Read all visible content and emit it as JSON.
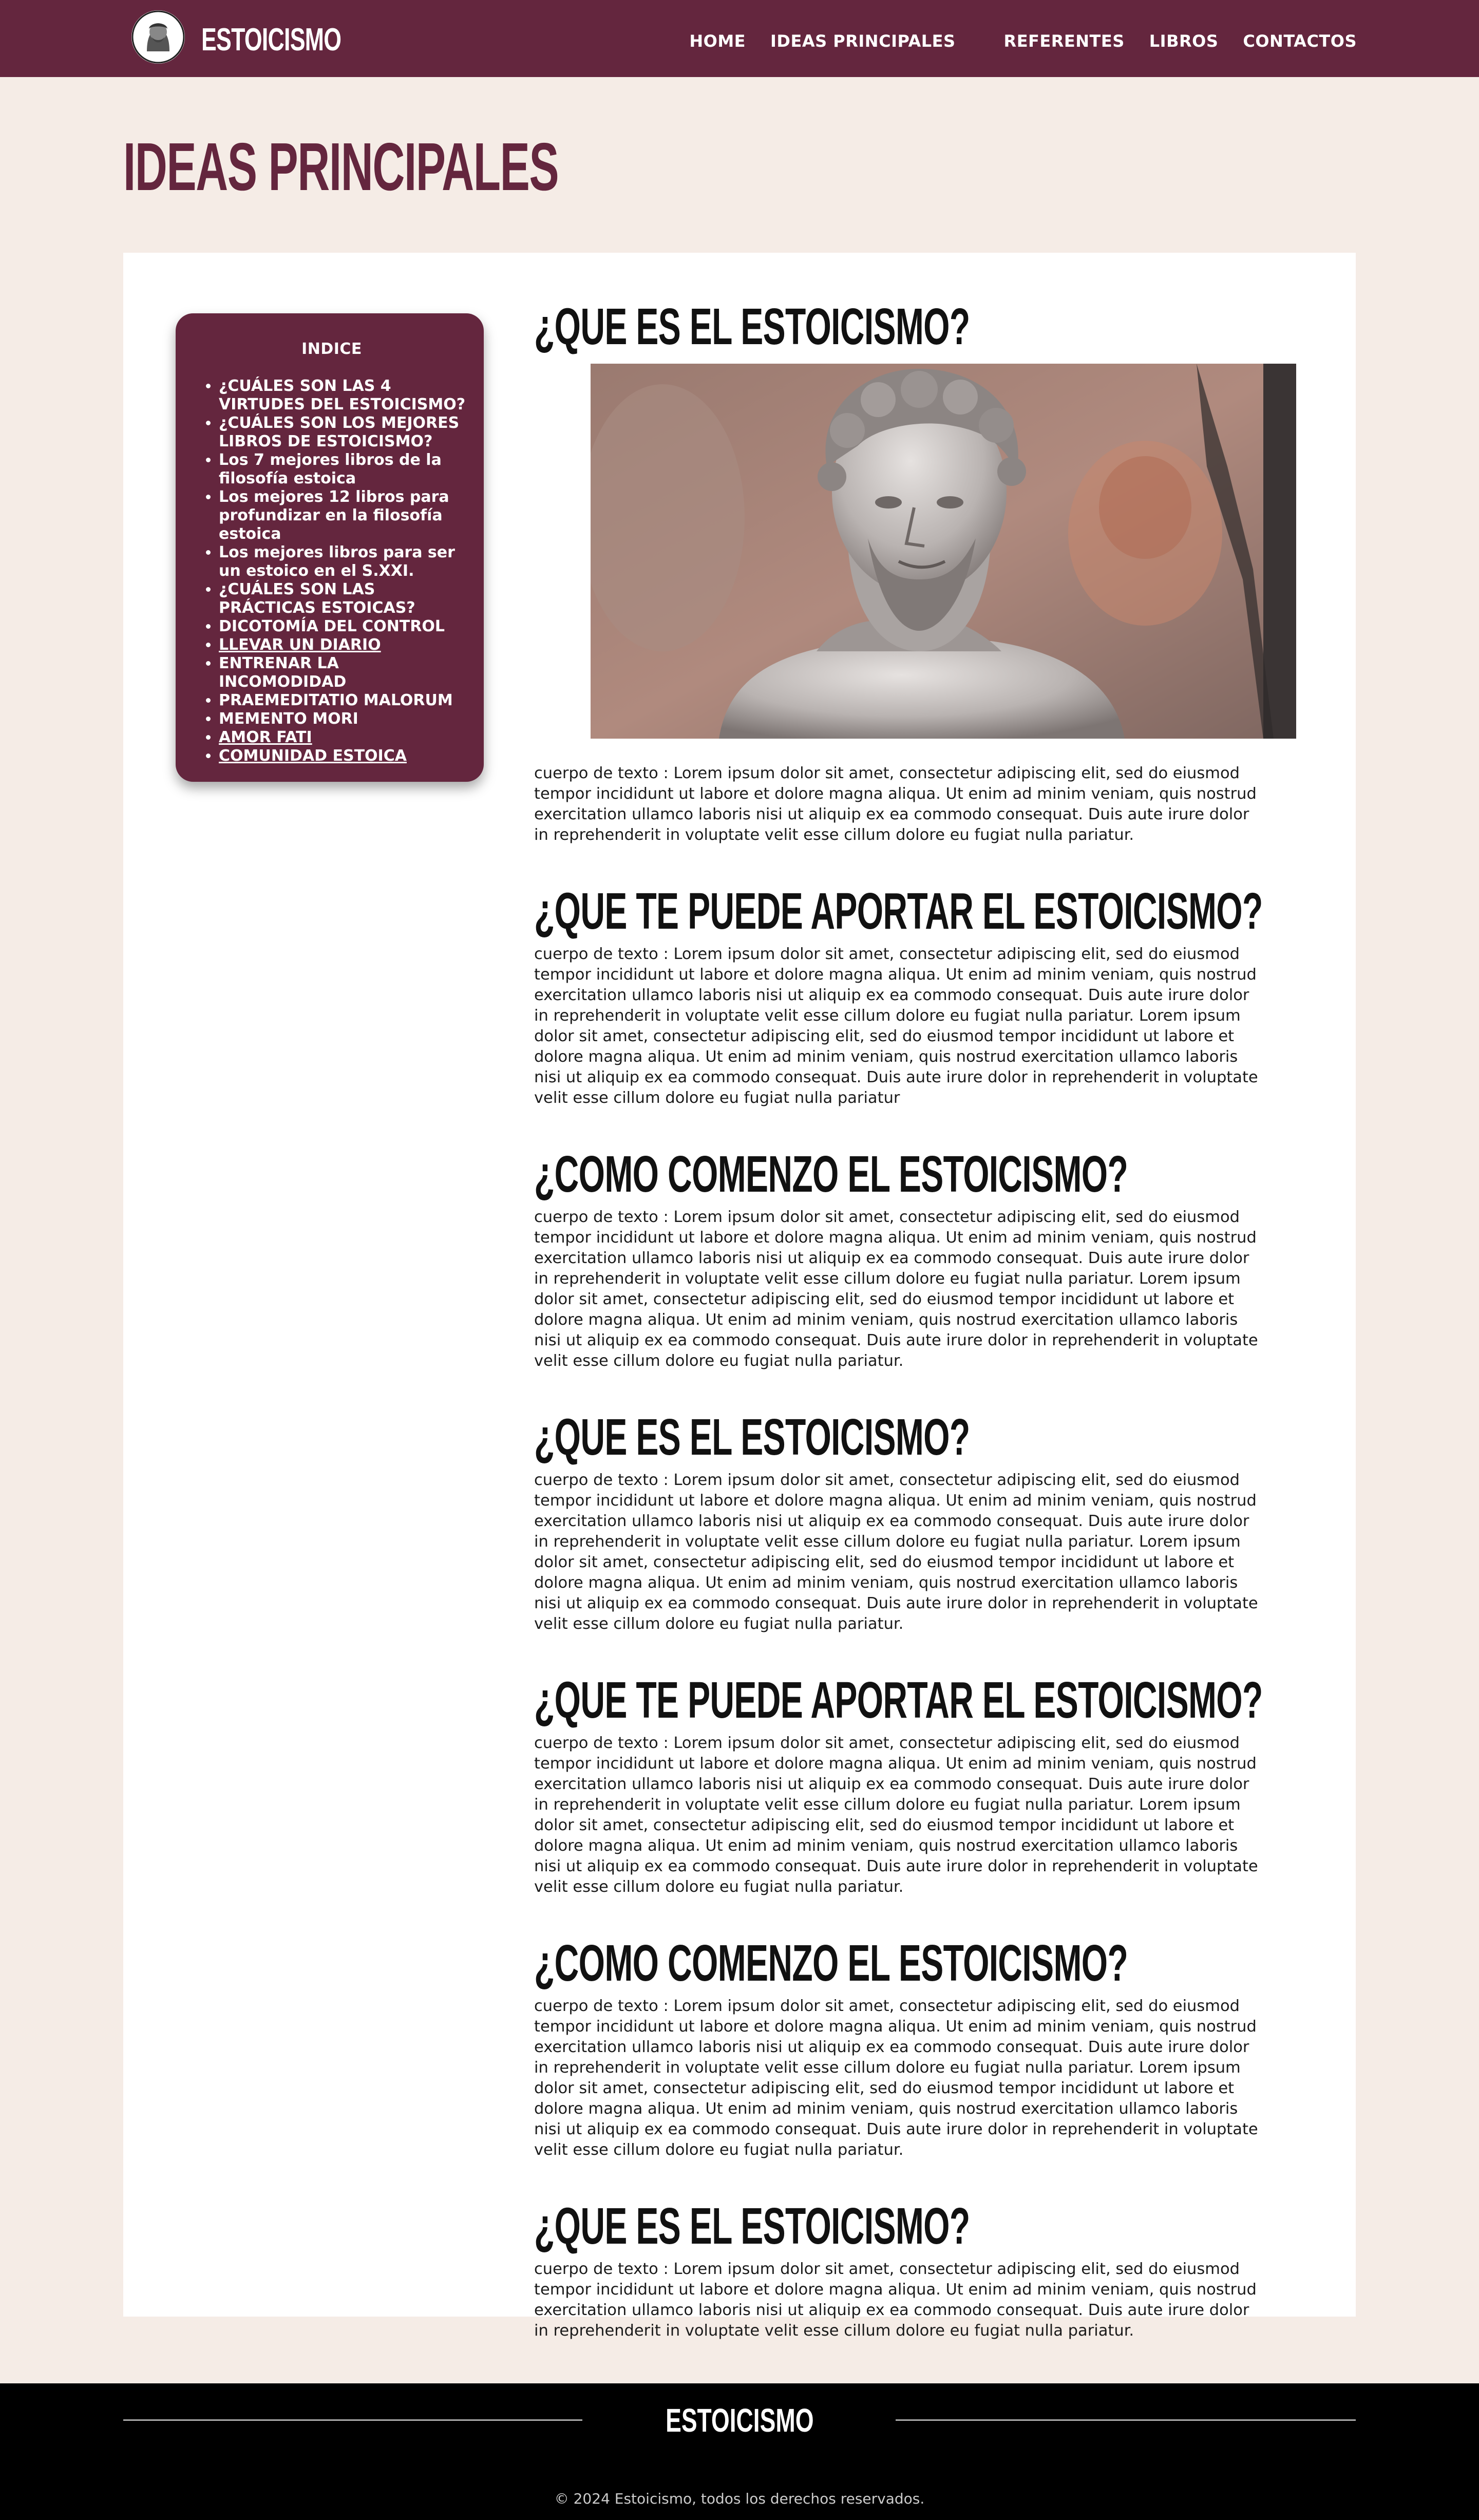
{
  "nav": {
    "brand": "ESTOICISMO",
    "logo_icon": "stoic-bust-logo-icon",
    "links": [
      "HOME",
      "IDEAS PRINCIPALES",
      "REFERENTES",
      "LIBROS",
      "CONTACTOS"
    ]
  },
  "page": {
    "title": "IDEAS PRINCIPALES"
  },
  "toc": {
    "title": "INDICE",
    "items": [
      "¿CUÁLES SON LAS 4 VIRTUDES DEL ESTOICISMO?",
      "¿CUÁLES SON LOS MEJORES LIBROS DE ESTOICISMO?",
      "Los 7 mejores libros de la filosofía estoica",
      "Los mejores 12 libros para profundizar en la filosofía estoica",
      "Los mejores libros para ser un estoico en el S.XXI.",
      "¿CUÁLES SON LAS PRÁCTICAS ESTOICAS?",
      "DICOTOMÍA DEL CONTROL",
      "LLEVAR UN DIARIO",
      "ENTRENAR LA INCOMODIDAD",
      "PRAEMEDITATIO MALORUM",
      "MEMENTO MORI",
      "AMOR FATI",
      "COMUNIDAD ESTOICA"
    ]
  },
  "image": {
    "alt": "Busto de mármol de Marco Aurelio"
  },
  "sections": [
    {
      "heading": "¿QUE ES EL ESTOICISMO?",
      "body": "cuerpo de texto : Lorem ipsum dolor sit amet, consectetur adipiscing elit, sed do eiusmod tempor incididunt ut labore et dolore magna aliqua. Ut enim ad minim veniam, quis nostrud exercitation ullamco laboris nisi ut aliquip ex ea commodo consequat. Duis aute irure dolor in reprehenderit in voluptate velit esse cillum dolore eu fugiat nulla pariatur."
    },
    {
      "heading": "¿QUE TE PUEDE APORTAR EL ESTOICISMO?",
      "body": "cuerpo de texto : Lorem ipsum dolor sit amet, consectetur adipiscing elit, sed do eiusmod tempor incididunt ut labore et dolore magna aliqua. Ut enim ad minim veniam, quis nostrud exercitation ullamco laboris nisi ut aliquip ex ea commodo consequat. Duis aute irure dolor in reprehenderit in voluptate velit esse cillum dolore eu fugiat nulla pariatur. Lorem ipsum dolor sit amet, consectetur adipiscing elit, sed do eiusmod tempor incididunt ut labore et dolore magna aliqua. Ut enim ad minim veniam, quis nostrud exercitation ullamco laboris nisi ut aliquip ex ea commodo consequat. Duis aute irure dolor in reprehenderit in voluptate velit esse cillum dolore eu fugiat nulla pariatur"
    },
    {
      "heading": "¿COMO COMENZO EL ESTOICISMO?",
      "body": "cuerpo de texto : Lorem ipsum dolor sit amet, consectetur adipiscing elit, sed do eiusmod tempor incididunt ut labore et dolore magna aliqua. Ut enim ad minim veniam, quis nostrud exercitation ullamco laboris nisi ut aliquip ex ea commodo consequat. Duis aute irure dolor in reprehenderit in voluptate velit esse cillum dolore eu fugiat nulla pariatur. Lorem ipsum dolor sit amet, consectetur adipiscing elit, sed do eiusmod tempor incididunt ut labore et dolore magna aliqua. Ut enim ad minim veniam, quis nostrud exercitation ullamco laboris nisi ut aliquip ex ea commodo consequat. Duis aute irure dolor in reprehenderit in voluptate velit esse cillum dolore eu fugiat nulla pariatur."
    },
    {
      "heading": "¿QUE ES EL ESTOICISMO?",
      "body": "cuerpo de texto : Lorem ipsum dolor sit amet, consectetur adipiscing elit, sed do eiusmod tempor incididunt ut labore et dolore magna aliqua. Ut enim ad minim veniam, quis nostrud exercitation ullamco laboris nisi ut aliquip ex ea commodo consequat. Duis aute irure dolor in reprehenderit in voluptate velit esse cillum dolore eu fugiat nulla pariatur. Lorem ipsum dolor sit amet, consectetur adipiscing elit, sed do eiusmod tempor incididunt ut labore et dolore magna aliqua. Ut enim ad minim veniam, quis nostrud exercitation ullamco laboris nisi ut aliquip ex ea commodo consequat. Duis aute irure dolor in reprehenderit in voluptate velit esse cillum dolore eu fugiat nulla pariatur."
    },
    {
      "heading": "¿QUE TE PUEDE APORTAR EL ESTOICISMO?",
      "body": "cuerpo de texto : Lorem ipsum dolor sit amet, consectetur adipiscing elit, sed do eiusmod tempor incididunt ut labore et dolore magna aliqua. Ut enim ad minim veniam, quis nostrud exercitation ullamco laboris nisi ut aliquip ex ea commodo consequat. Duis aute irure dolor in reprehenderit in voluptate velit esse cillum dolore eu fugiat nulla pariatur. Lorem ipsum dolor sit amet, consectetur adipiscing elit, sed do eiusmod tempor incididunt ut labore et dolore magna aliqua. Ut enim ad minim veniam, quis nostrud exercitation ullamco laboris nisi ut aliquip ex ea commodo consequat. Duis aute irure dolor in reprehenderit in voluptate velit esse cillum dolore eu fugiat nulla pariatur."
    },
    {
      "heading": "¿COMO COMENZO EL ESTOICISMO?",
      "body": "cuerpo de texto : Lorem ipsum dolor sit amet, consectetur adipiscing elit, sed do eiusmod tempor incididunt ut labore et dolore magna aliqua. Ut enim ad minim veniam, quis nostrud exercitation ullamco laboris nisi ut aliquip ex ea commodo consequat. Duis aute irure dolor in reprehenderit in voluptate velit esse cillum dolore eu fugiat nulla pariatur. Lorem ipsum dolor sit amet, consectetur adipiscing elit, sed do eiusmod tempor incididunt ut labore et dolore magna aliqua. Ut enim ad minim veniam, quis nostrud exercitation ullamco laboris nisi ut aliquip ex ea commodo consequat. Duis aute irure dolor in reprehenderit in voluptate velit esse cillum dolore eu fugiat nulla pariatur."
    },
    {
      "heading": "¿QUE ES EL ESTOICISMO?",
      "body": "cuerpo de texto : Lorem ipsum dolor sit amet, consectetur adipiscing elit, sed do eiusmod tempor incididunt ut labore et dolore magna aliqua. Ut enim ad minim veniam, quis nostrud exercitation ullamco laboris nisi ut aliquip ex ea commodo consequat. Duis aute irure dolor in reprehenderit in voluptate velit esse cillum dolore eu fugiat nulla pariatur."
    }
  ],
  "footer": {
    "brand": "ESTOICISMO",
    "copyright": "© 2024 Estoicismo, todos los derechos reservados."
  },
  "colors": {
    "primary": "#64263e",
    "background": "#f5ece6",
    "footer": "#000000"
  }
}
